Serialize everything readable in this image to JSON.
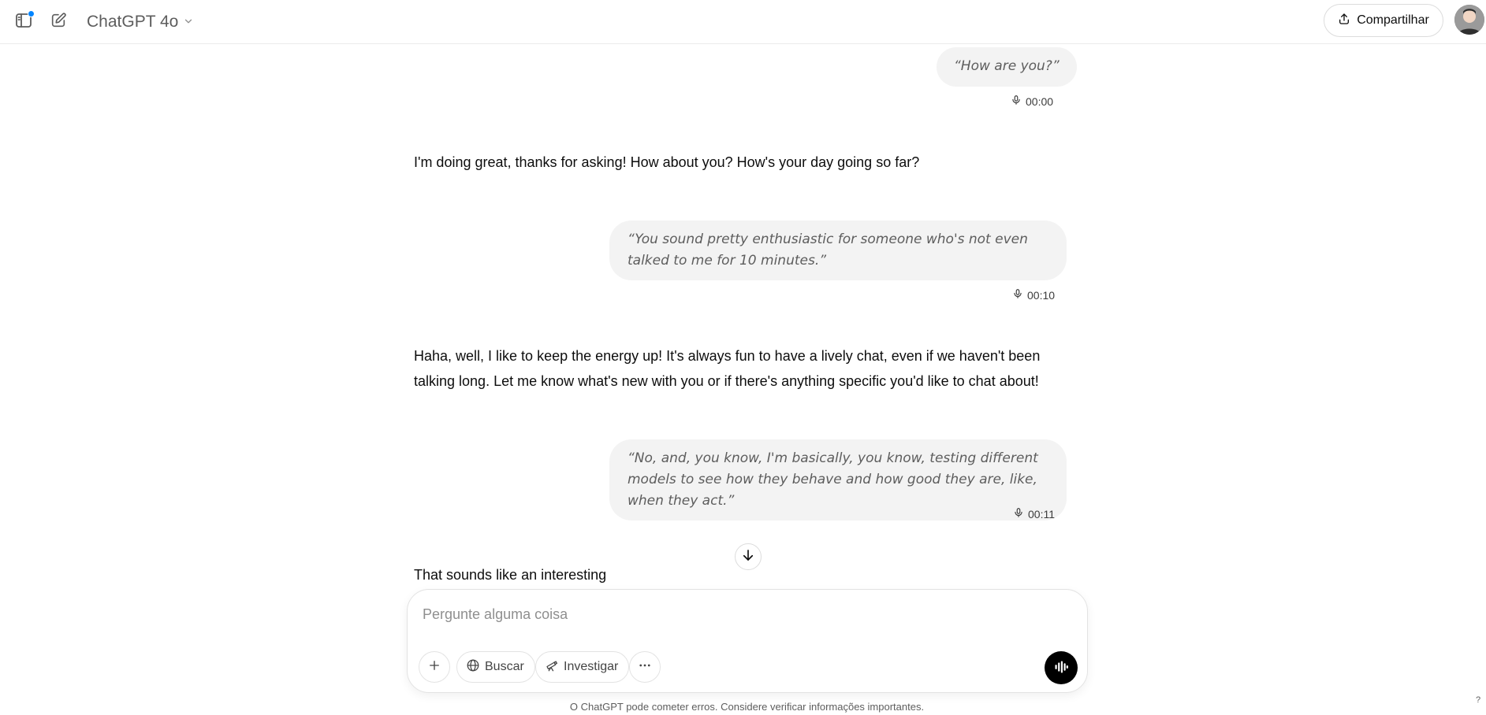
{
  "header": {
    "sidebar_icon": "sidebar-toggle-icon",
    "new_chat_icon": "new-chat-edit-icon",
    "model_name": "ChatGPT 4o",
    "share_label": "Compartilhar",
    "accent_color": "#0285ff"
  },
  "conversation": {
    "messages": [
      {
        "role": "user",
        "type": "voice",
        "text": "“How are you?”",
        "duration": "00:00"
      },
      {
        "role": "assistant",
        "text": "I'm doing great, thanks for asking! How about you? How's your day going so far?"
      },
      {
        "role": "user",
        "type": "voice",
        "text": "“You sound pretty enthusiastic for someone who's not even talked to me for 10 minutes.”",
        "duration": "00:10"
      },
      {
        "role": "assistant",
        "text": "Haha, well, I like to keep the energy up! It's always fun to have a lively chat, even if we haven't been talking long. Let me know what's new with you or if there's anything specific you'd like to chat about!"
      },
      {
        "role": "user",
        "type": "voice",
        "text": "“No, and, you know, I'm basically, you know, testing different models to see how they behave and how good they are, like, when they act.”",
        "duration": "00:11"
      },
      {
        "role": "assistant",
        "text": "That sounds like an interesting"
      }
    ]
  },
  "composer": {
    "placeholder": "Pergunte alguma coisa",
    "value": "",
    "tools": {
      "search_label": "Buscar",
      "research_label": "Investigar"
    }
  },
  "footer": {
    "disclaimer": "O ChatGPT pode cometer erros. Considere verificar informações importantes.",
    "help_label": "?"
  }
}
